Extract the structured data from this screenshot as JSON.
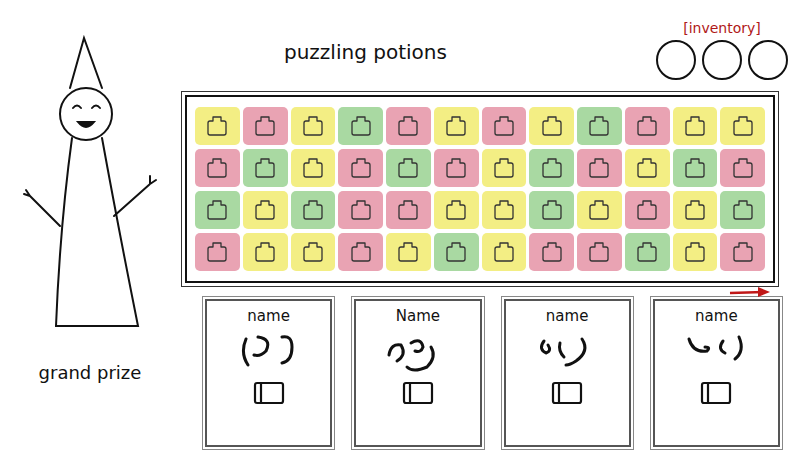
{
  "title": "puzzling potions",
  "inventory": {
    "label": "[inventory]",
    "slots": [
      {
        "filled": false
      },
      {
        "filled": false
      },
      {
        "filled": false
      }
    ]
  },
  "prize": {
    "label": "grand prize"
  },
  "grid": {
    "rows": [
      [
        {
          "color": "#f3ee84"
        },
        {
          "color": "#e9a3b3"
        },
        {
          "color": "#f3ee84"
        },
        {
          "color": "#a9d9a2"
        },
        {
          "color": "#e9a3b3"
        },
        {
          "color": "#f3ee84"
        },
        {
          "color": "#e9a3b3"
        },
        {
          "color": "#f3ee84"
        },
        {
          "color": "#a9d9a2"
        },
        {
          "color": "#e9a3b3"
        },
        {
          "color": "#f3ee84"
        },
        {
          "color": "#f3ee84"
        }
      ],
      [
        {
          "color": "#e9a3b3"
        },
        {
          "color": "#a9d9a2"
        },
        {
          "color": "#f3ee84"
        },
        {
          "color": "#e9a3b3"
        },
        {
          "color": "#a9d9a2"
        },
        {
          "color": "#e9a3b3"
        },
        {
          "color": "#f3ee84"
        },
        {
          "color": "#a9d9a2"
        },
        {
          "color": "#e9a3b3"
        },
        {
          "color": "#f3ee84"
        },
        {
          "color": "#a9d9a2"
        },
        {
          "color": "#e9a3b3"
        }
      ],
      [
        {
          "color": "#a9d9a2"
        },
        {
          "color": "#f3ee84"
        },
        {
          "color": "#a9d9a2"
        },
        {
          "color": "#e9a3b3"
        },
        {
          "color": "#e9a3b3"
        },
        {
          "color": "#f3ee84"
        },
        {
          "color": "#f3ee84"
        },
        {
          "color": "#a9d9a2"
        },
        {
          "color": "#f3ee84"
        },
        {
          "color": "#e9a3b3"
        },
        {
          "color": "#f3ee84"
        },
        {
          "color": "#a9d9a2"
        }
      ],
      [
        {
          "color": "#e9a3b3"
        },
        {
          "color": "#f3ee84"
        },
        {
          "color": "#f3ee84"
        },
        {
          "color": "#e9a3b3"
        },
        {
          "color": "#f3ee84"
        },
        {
          "color": "#a9d9a2"
        },
        {
          "color": "#f3ee84"
        },
        {
          "color": "#e9a3b3"
        },
        {
          "color": "#e9a3b3"
        },
        {
          "color": "#a9d9a2"
        },
        {
          "color": "#f3ee84"
        },
        {
          "color": "#e9a3b3"
        }
      ]
    ]
  },
  "recipes": [
    {
      "name": "name"
    },
    {
      "name": "Name"
    },
    {
      "name": "name"
    },
    {
      "name": "name"
    }
  ]
}
